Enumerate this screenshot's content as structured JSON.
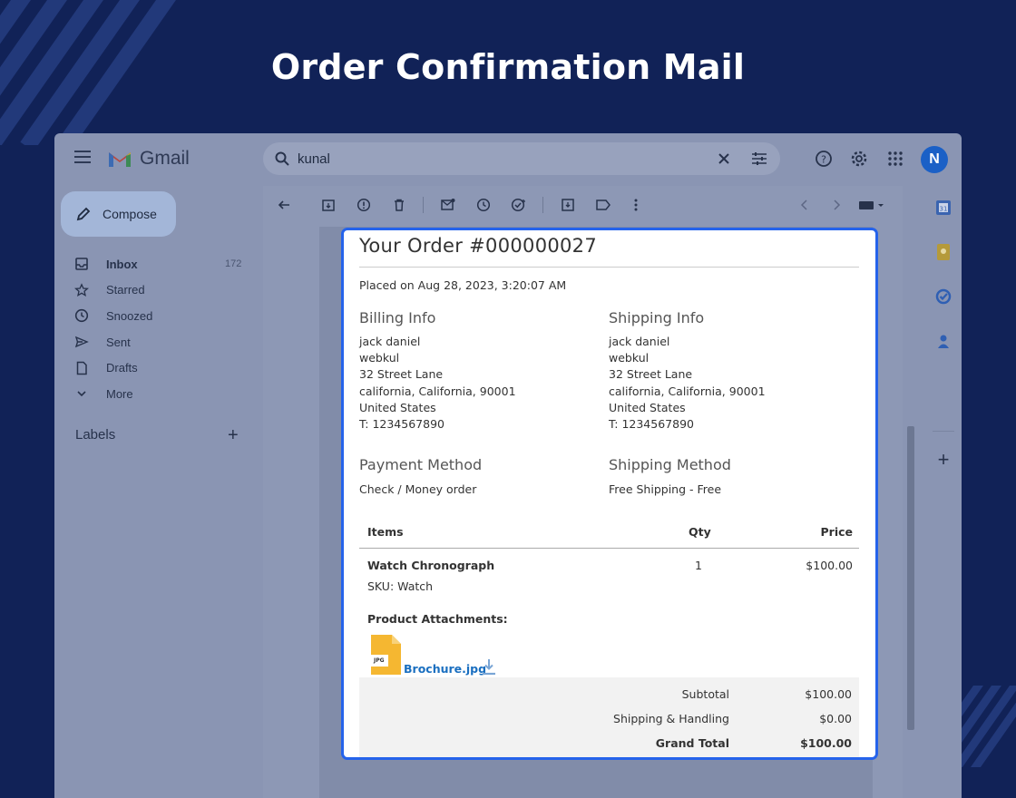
{
  "hero": {
    "title": "Order Confirmation Mail"
  },
  "gmail": {
    "brand": "Gmail",
    "search": {
      "query": "kunal"
    },
    "avatar_letter": "N",
    "compose_label": "Compose",
    "nav": [
      {
        "label": "Inbox",
        "count": "172",
        "icon": "inbox-icon"
      },
      {
        "label": "Starred",
        "icon": "star-icon"
      },
      {
        "label": "Snoozed",
        "icon": "clock-icon"
      },
      {
        "label": "Sent",
        "icon": "send-icon"
      },
      {
        "label": "Drafts",
        "icon": "draft-icon"
      },
      {
        "label": "More",
        "icon": "chevron-down-icon"
      }
    ],
    "labels_title": "Labels"
  },
  "email": {
    "order_title": "Your Order #000000027",
    "placed": "Placed on Aug 28, 2023, 3:20:07 AM",
    "billing": {
      "heading": "Billing Info",
      "lines": [
        "jack daniel",
        "webkul",
        "32 Street Lane",
        "california, California, 90001",
        "United States",
        "T: 1234567890"
      ]
    },
    "shipping": {
      "heading": "Shipping Info",
      "lines": [
        "jack daniel",
        "webkul",
        "32 Street Lane",
        "california, California, 90001",
        "United States",
        "T: 1234567890"
      ]
    },
    "payment": {
      "heading": "Payment Method",
      "value": "Check / Money order"
    },
    "shipping_method": {
      "heading": "Shipping Method",
      "value": "Free Shipping - Free"
    },
    "table": {
      "headers": {
        "items": "Items",
        "qty": "Qty",
        "price": "Price"
      },
      "item": {
        "name": "Watch Chronograph",
        "sku": "SKU: Watch",
        "qty": "1",
        "price": "$100.00"
      }
    },
    "attachments": {
      "heading": "Product Attachments:",
      "file_label": "JPG",
      "file": "Brochure.jpg"
    },
    "totals": [
      {
        "label": "Subtotal",
        "value": "$100.00"
      },
      {
        "label": "Shipping & Handling",
        "value": "$0.00"
      },
      {
        "label": "Grand Total",
        "value": "$100.00"
      }
    ]
  },
  "colors": {
    "page_bg": "#112257",
    "highlight_border": "#2563eb",
    "link": "#1a6fc0",
    "avatar": "#1b60c6"
  }
}
